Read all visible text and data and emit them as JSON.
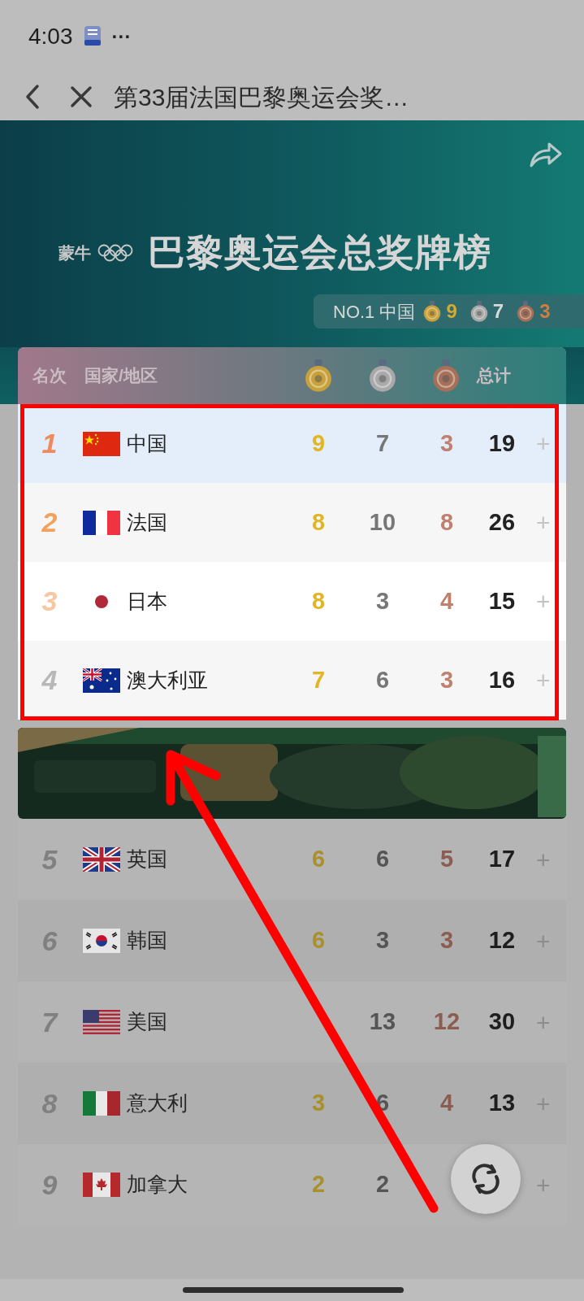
{
  "status_bar": {
    "time": "4:03",
    "more": "···"
  },
  "header": {
    "title": "第33届法国巴黎奥运会奖…"
  },
  "banner": {
    "logo_text": "蒙牛",
    "title": "巴黎奥运会总奖牌榜",
    "leader": {
      "label": "NO.1 中国",
      "gold": "9",
      "silver": "7",
      "bronze": "3"
    }
  },
  "table": {
    "columns": [
      {
        "kind": "text",
        "label": "名次"
      },
      {
        "kind": "text",
        "label": "国家/地区"
      },
      {
        "kind": "gold_medal"
      },
      {
        "kind": "silver_medal"
      },
      {
        "kind": "bronze_medal"
      },
      {
        "kind": "text",
        "label": "总计"
      }
    ],
    "rows": [
      {
        "kind": "row",
        "rank": "1",
        "color": "#f08a5d",
        "country": "中国",
        "gold": "9",
        "silver": "7",
        "bronze": "3",
        "total": "19",
        "expand": "+",
        "selected": true,
        "highlighted": true
      },
      {
        "kind": "row",
        "rank": "2",
        "color": "#f4a15e",
        "country": "法国",
        "gold": "8",
        "silver": "10",
        "bronze": "8",
        "total": "26",
        "expand": "+",
        "selected": false,
        "highlighted": true
      },
      {
        "kind": "row",
        "rank": "3",
        "color": "#f7c7a0",
        "country": "日本",
        "gold": "8",
        "silver": "3",
        "bronze": "4",
        "total": "15",
        "expand": "+",
        "selected": false,
        "highlighted": true
      },
      {
        "kind": "row",
        "rank": "4",
        "color": "#b8b8b8",
        "country": "澳大利亚",
        "gold": "7",
        "silver": "6",
        "bronze": "3",
        "total": "16",
        "expand": "+",
        "selected": false,
        "highlighted": true
      },
      {
        "kind": "ad"
      },
      {
        "kind": "row",
        "rank": "5",
        "color": "#808080",
        "country": "英国",
        "gold": "6",
        "silver": "6",
        "bronze": "5",
        "total": "17",
        "expand": "+",
        "selected": false,
        "highlighted": false
      },
      {
        "kind": "row",
        "rank": "6",
        "color": "#808080",
        "country": "韩国",
        "gold": "6",
        "silver": "3",
        "bronze": "3",
        "total": "12",
        "expand": "+",
        "selected": false,
        "highlighted": false
      },
      {
        "kind": "row",
        "rank": "7",
        "color": "#808080",
        "country": "美国",
        "silver": "13",
        "bronze": "12",
        "total": "30",
        "expand": "+",
        "selected": false,
        "highlighted": false
      },
      {
        "kind": "row",
        "rank": "8",
        "color": "#808080",
        "country": "意大利",
        "gold": "3",
        "silver": "6",
        "bronze": "4",
        "total": "13",
        "expand": "+",
        "selected": false,
        "highlighted": false
      },
      {
        "kind": "row",
        "rank": "9",
        "color": "#808080",
        "country": "加拿大",
        "gold": "2",
        "silver": "2",
        "expand": "+",
        "selected": false,
        "highlighted": false
      }
    ]
  }
}
